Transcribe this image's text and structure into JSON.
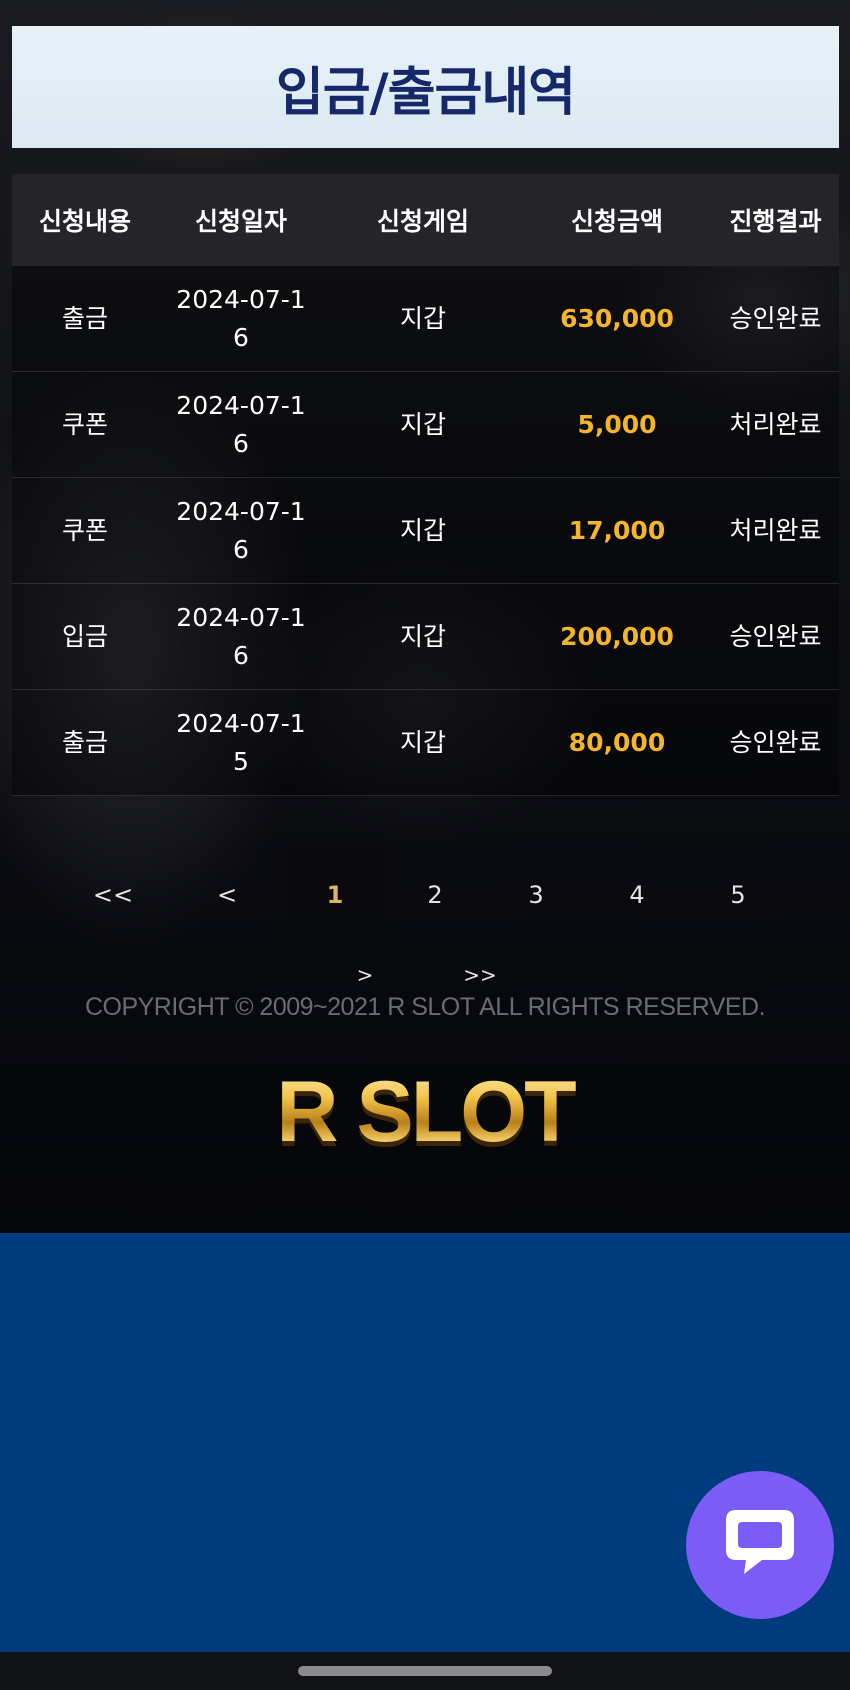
{
  "page": {
    "title": "입금/출금내역"
  },
  "table": {
    "headers": [
      "신청내용",
      "신청일자",
      "신청게임",
      "신청금액",
      "진행결과"
    ],
    "rows": [
      {
        "type": "출금",
        "date": "2024-07-16",
        "game": "지갑",
        "amount": "630,000",
        "result": "승인완료"
      },
      {
        "type": "쿠폰",
        "date": "2024-07-16",
        "game": "지갑",
        "amount": "5,000",
        "result": "처리완료"
      },
      {
        "type": "쿠폰",
        "date": "2024-07-16",
        "game": "지갑",
        "amount": "17,000",
        "result": "처리완료"
      },
      {
        "type": "입금",
        "date": "2024-07-16",
        "game": "지갑",
        "amount": "200,000",
        "result": "승인완료"
      },
      {
        "type": "출금",
        "date": "2024-07-15",
        "game": "지갑",
        "amount": "80,000",
        "result": "승인완료"
      }
    ]
  },
  "pagination": {
    "first": "<<",
    "prev": "<",
    "pages": [
      "1",
      "2",
      "3",
      "4",
      "5"
    ],
    "active_page": "1",
    "next": ">",
    "last": ">>"
  },
  "footer": {
    "copyright": "COPYRIGHT © 2009~2021 R SLOT ALL RIGHTS RESERVED.",
    "logo_text": "R SLOT"
  },
  "colors": {
    "title_text": "#16276a",
    "amount": "#f5b52a",
    "active_page": "#d9b56a",
    "bottom_panel": "#003b7e",
    "chat_button": "#7b5cf6"
  },
  "icons": {
    "chat": "chat-bubble-icon"
  }
}
